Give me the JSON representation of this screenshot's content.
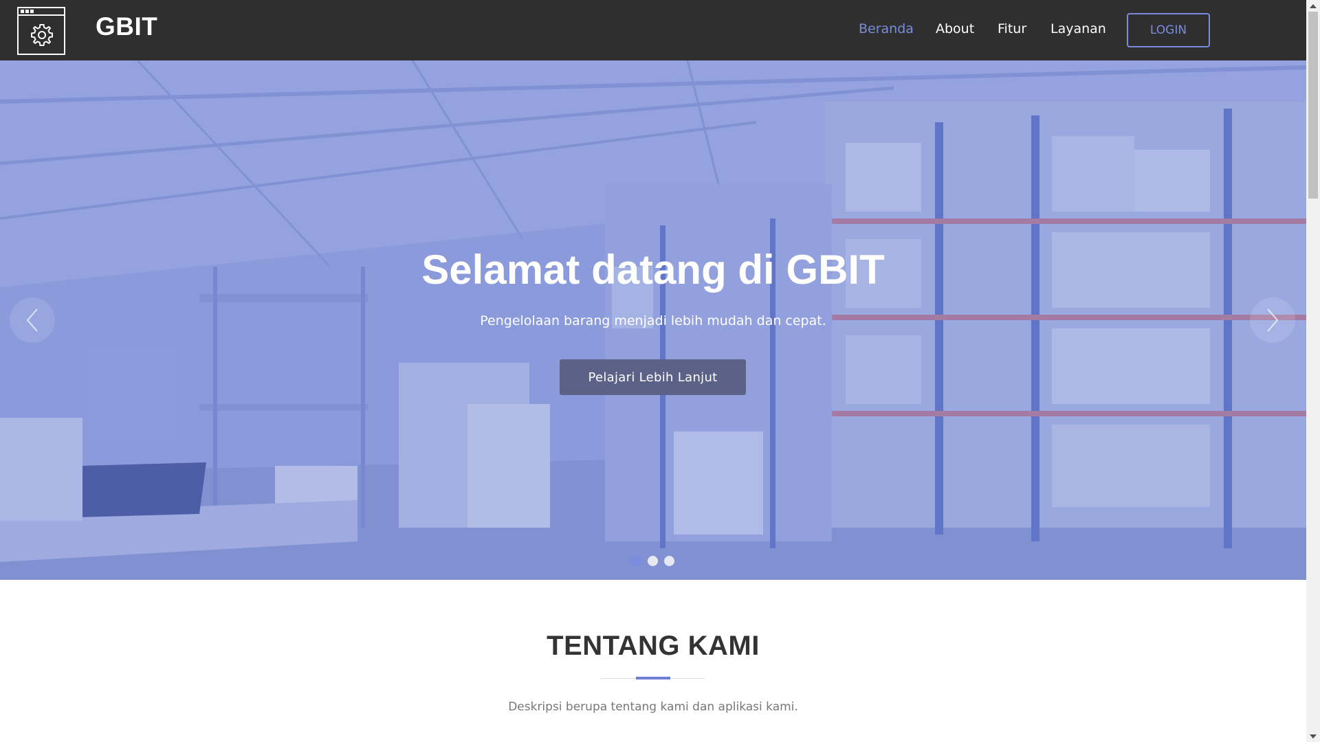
{
  "header": {
    "brand": "GBIT",
    "logo_icon": "gear-icon",
    "nav": [
      {
        "label": "Beranda",
        "active": true
      },
      {
        "label": "About",
        "active": false
      },
      {
        "label": "Fitur",
        "active": false
      },
      {
        "label": "Layanan",
        "active": false
      }
    ],
    "login_label": "LOGIN"
  },
  "hero": {
    "title": "Selamat datang di GBIT",
    "subtitle": "Pengelolaan barang menjadi lebih mudah dan cepat.",
    "button_label": "Pelajari Lebih Lanjut",
    "prev_icon": "chevron-left-icon",
    "next_icon": "chevron-right-icon",
    "slides_total": 3,
    "active_slide": 1
  },
  "about": {
    "title": "TENTANG KAMI",
    "description": "Deskripsi berupa tentang kami dan aplikasi kami."
  },
  "colors": {
    "navbar": "#2f2f2f",
    "accent": "#7b8ce0",
    "hero_button": "#5c6287",
    "heading": "#333333"
  }
}
